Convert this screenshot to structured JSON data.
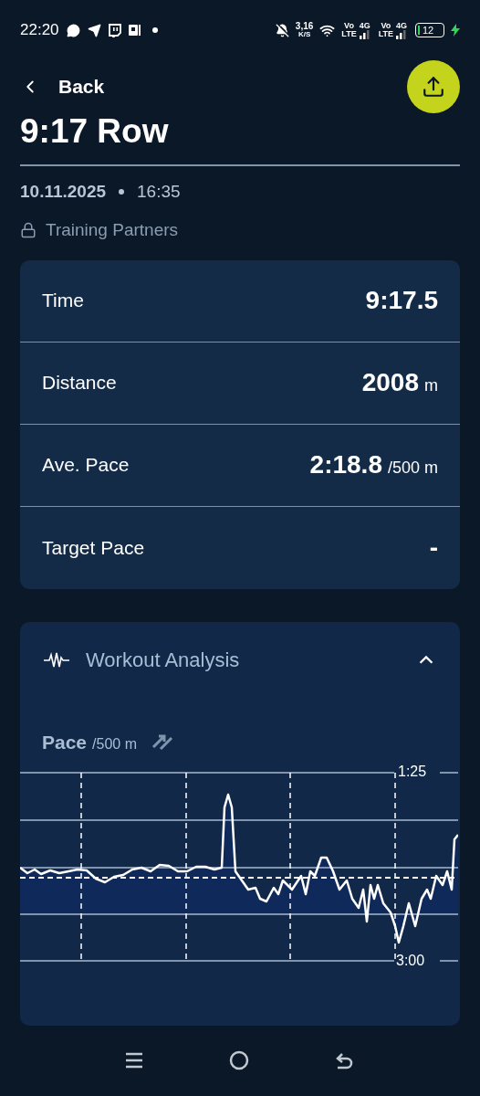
{
  "status_bar": {
    "time": "22:20",
    "speed": "3,16",
    "speed_unit": "K/S",
    "sims": [
      {
        "volte_top": "Vo",
        "volte_bottom": "LTE",
        "network": "4G"
      },
      {
        "volte_top": "Vo",
        "volte_bottom": "LTE",
        "network": "4G"
      }
    ],
    "battery": "12",
    "charging": true
  },
  "header": {
    "back_label": "Back"
  },
  "workout": {
    "title": "9:17 Row",
    "date": "10.11.2025",
    "time": "16:35",
    "visibility": "Training Partners"
  },
  "stats": [
    {
      "label": "Time",
      "value": "9:17.5"
    },
    {
      "label": "Distance",
      "value": "2008",
      "unit": "m"
    },
    {
      "label": "Ave. Pace",
      "value": "2:18.8",
      "unit": "/500 m"
    },
    {
      "label": "Target Pace",
      "value": "-"
    }
  ],
  "analysis": {
    "title": "Workout Analysis",
    "expanded": true,
    "metric": "Pace",
    "metric_unit": "/500 m",
    "axis_labels": [
      "1:25",
      "3:00"
    ]
  }
}
